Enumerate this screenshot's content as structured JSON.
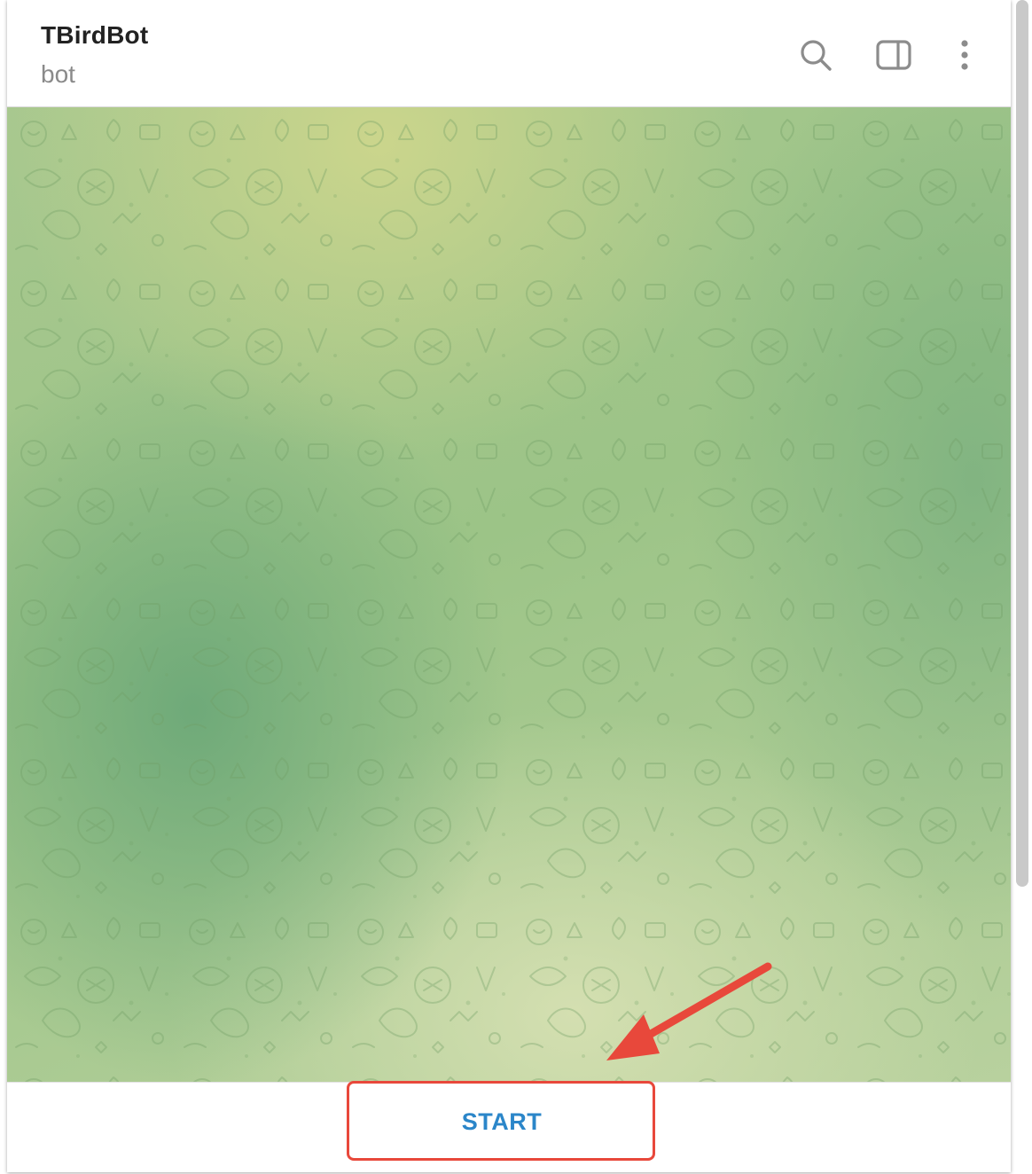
{
  "header": {
    "title": "TBirdBot",
    "subtitle": "bot",
    "icons": [
      "search-icon",
      "sidebar-toggle-icon",
      "more-vertical-icon"
    ]
  },
  "footer": {
    "start_label": "START"
  },
  "annotation": {
    "highlight_color": "#e8483b",
    "target": "start-button"
  },
  "colors": {
    "accent": "#2b86c9",
    "chat_background": "#9cc487"
  }
}
